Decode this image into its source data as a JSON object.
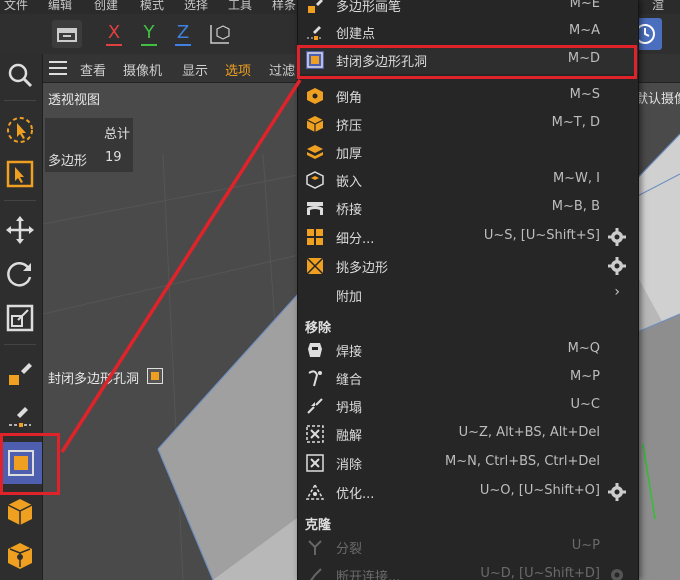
{
  "menubar": {
    "items": [
      "文件",
      "编辑",
      "创建",
      "模式",
      "选择",
      "工具",
      "样条",
      "渲"
    ]
  },
  "toolbar": {
    "x_label": "X",
    "y_label": "Y",
    "z_label": "Z"
  },
  "viewport_menu": {
    "items": [
      "查看",
      "摄像机",
      "显示",
      "选项",
      "过滤"
    ],
    "right_label": "默认摄像机"
  },
  "viewport": {
    "title": "透视视图",
    "stats_header": "总计",
    "stats_label": "多边形",
    "stats_value": "19",
    "tool_hint": "封闭多边形孔洞"
  },
  "context_menu": {
    "items": [
      {
        "label": "多边形画笔",
        "shortcut": "M~E",
        "icon": "polygon-pen-icon"
      },
      {
        "label": "创建点",
        "shortcut": "M~A",
        "icon": "create-point-icon"
      },
      {
        "label": "封闭多边形孔洞",
        "shortcut": "M~D",
        "icon": "close-polygon-hole-icon"
      },
      {
        "label": "倒角",
        "shortcut": "M~S",
        "icon": "bevel-icon"
      },
      {
        "label": "挤压",
        "shortcut": "M~T, D",
        "icon": "extrude-icon"
      },
      {
        "label": "加厚",
        "shortcut": "",
        "icon": "thicken-icon"
      },
      {
        "label": "嵌入",
        "shortcut": "M~W, I",
        "icon": "inner-extrude-icon"
      },
      {
        "label": "桥接",
        "shortcut": "M~B, B",
        "icon": "bridge-icon"
      },
      {
        "label": "细分...",
        "shortcut": "U~S, [U~Shift+S]",
        "icon": "subdivide-icon"
      },
      {
        "label": "挑多边形",
        "shortcut": "",
        "icon": "pick-polygon-icon"
      },
      {
        "label": "附加",
        "shortcut": "",
        "icon": "submenu-arrow-icon"
      }
    ],
    "section_remove": "移除",
    "remove_items": [
      {
        "label": "焊接",
        "shortcut": "M~Q",
        "icon": "weld-icon"
      },
      {
        "label": "缝合",
        "shortcut": "M~P",
        "icon": "stitch-icon"
      },
      {
        "label": "坍塌",
        "shortcut": "U~C",
        "icon": "collapse-icon"
      },
      {
        "label": "融解",
        "shortcut": "U~Z, Alt+BS, Alt+Del",
        "icon": "dissolve-icon"
      },
      {
        "label": "消除",
        "shortcut": "M~N, Ctrl+BS, Ctrl+Del",
        "icon": "melt-icon"
      },
      {
        "label": "优化...",
        "shortcut": "U~O, [U~Shift+O]",
        "icon": "optimize-icon"
      }
    ],
    "section_clone": "克隆",
    "clone_items": [
      {
        "label": "分裂",
        "shortcut": "U~P",
        "icon": "split-icon"
      },
      {
        "label": "断开连接...",
        "shortcut": "U~D, [U~Shift+D]",
        "icon": "disconnect-icon"
      }
    ]
  },
  "colors": {
    "accent_orange": "#f0a020",
    "highlight_red": "#e0232b",
    "axis_x": "#e04040",
    "axis_y": "#40c040",
    "axis_z": "#4080e0"
  }
}
